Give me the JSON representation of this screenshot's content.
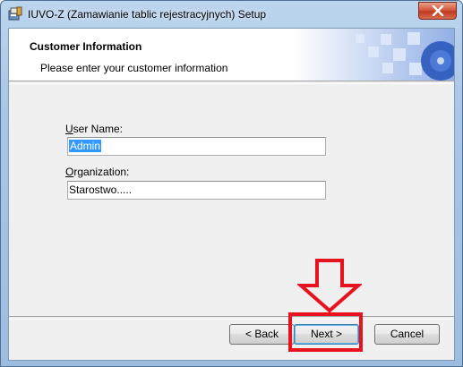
{
  "window": {
    "title": "IUVO-Z (Zamawianie tablic rejestracyjnych) Setup"
  },
  "banner": {
    "title": "Customer Information",
    "subtitle": "Please enter your customer information"
  },
  "form": {
    "user_name": {
      "label_accel": "U",
      "label_rest": "ser Name:",
      "value": "Admin"
    },
    "organization": {
      "label_accel": "O",
      "label_rest": "rganization:",
      "value": "Starostwo....."
    }
  },
  "buttons": {
    "back": "< Back",
    "next": "Next >",
    "cancel": "Cancel"
  },
  "icons": {
    "app": "installer-icon",
    "close": "close-icon",
    "annotation": "down-arrow-annotation"
  },
  "colors": {
    "annotation_red": "#e8121e",
    "selection_blue": "#3399ff"
  }
}
